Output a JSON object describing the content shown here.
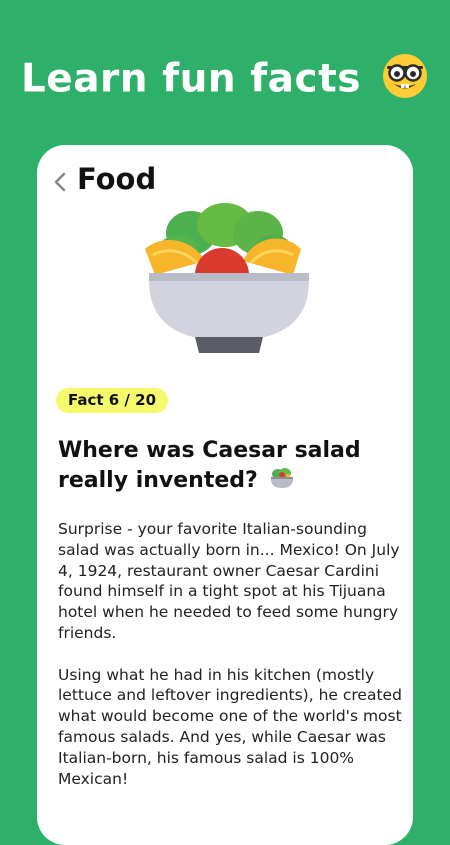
{
  "promo": {
    "headline": "Learn fun facts",
    "emoji_icon": "nerd-face-icon"
  },
  "card": {
    "back_icon": "chevron-left-icon",
    "category": "Food",
    "illustration": "salad-bowl-illustration",
    "fact_counter": "Fact 6 / 20",
    "question": "Where was Caesar salad really invented?",
    "question_emoji": "salad-icon",
    "paragraphs": [
      "Surprise - your favorite Italian-sounding salad was actually born in... Mexico! On July 4, 1924, restaurant owner Caesar Cardini found himself in a tight spot at his Tijuana hotel when he needed to feed some hungry friends.",
      "Using what he had in his kitchen (mostly lettuce and leftover ingredients), he created what would become one of the world's most famous salads. And yes, while Caesar was Italian-born, his famous salad is 100% Mexican!"
    ]
  },
  "colors": {
    "background": "#2eb06a",
    "card": "#ffffff",
    "badge": "#f6f96b",
    "text": "#111111"
  }
}
